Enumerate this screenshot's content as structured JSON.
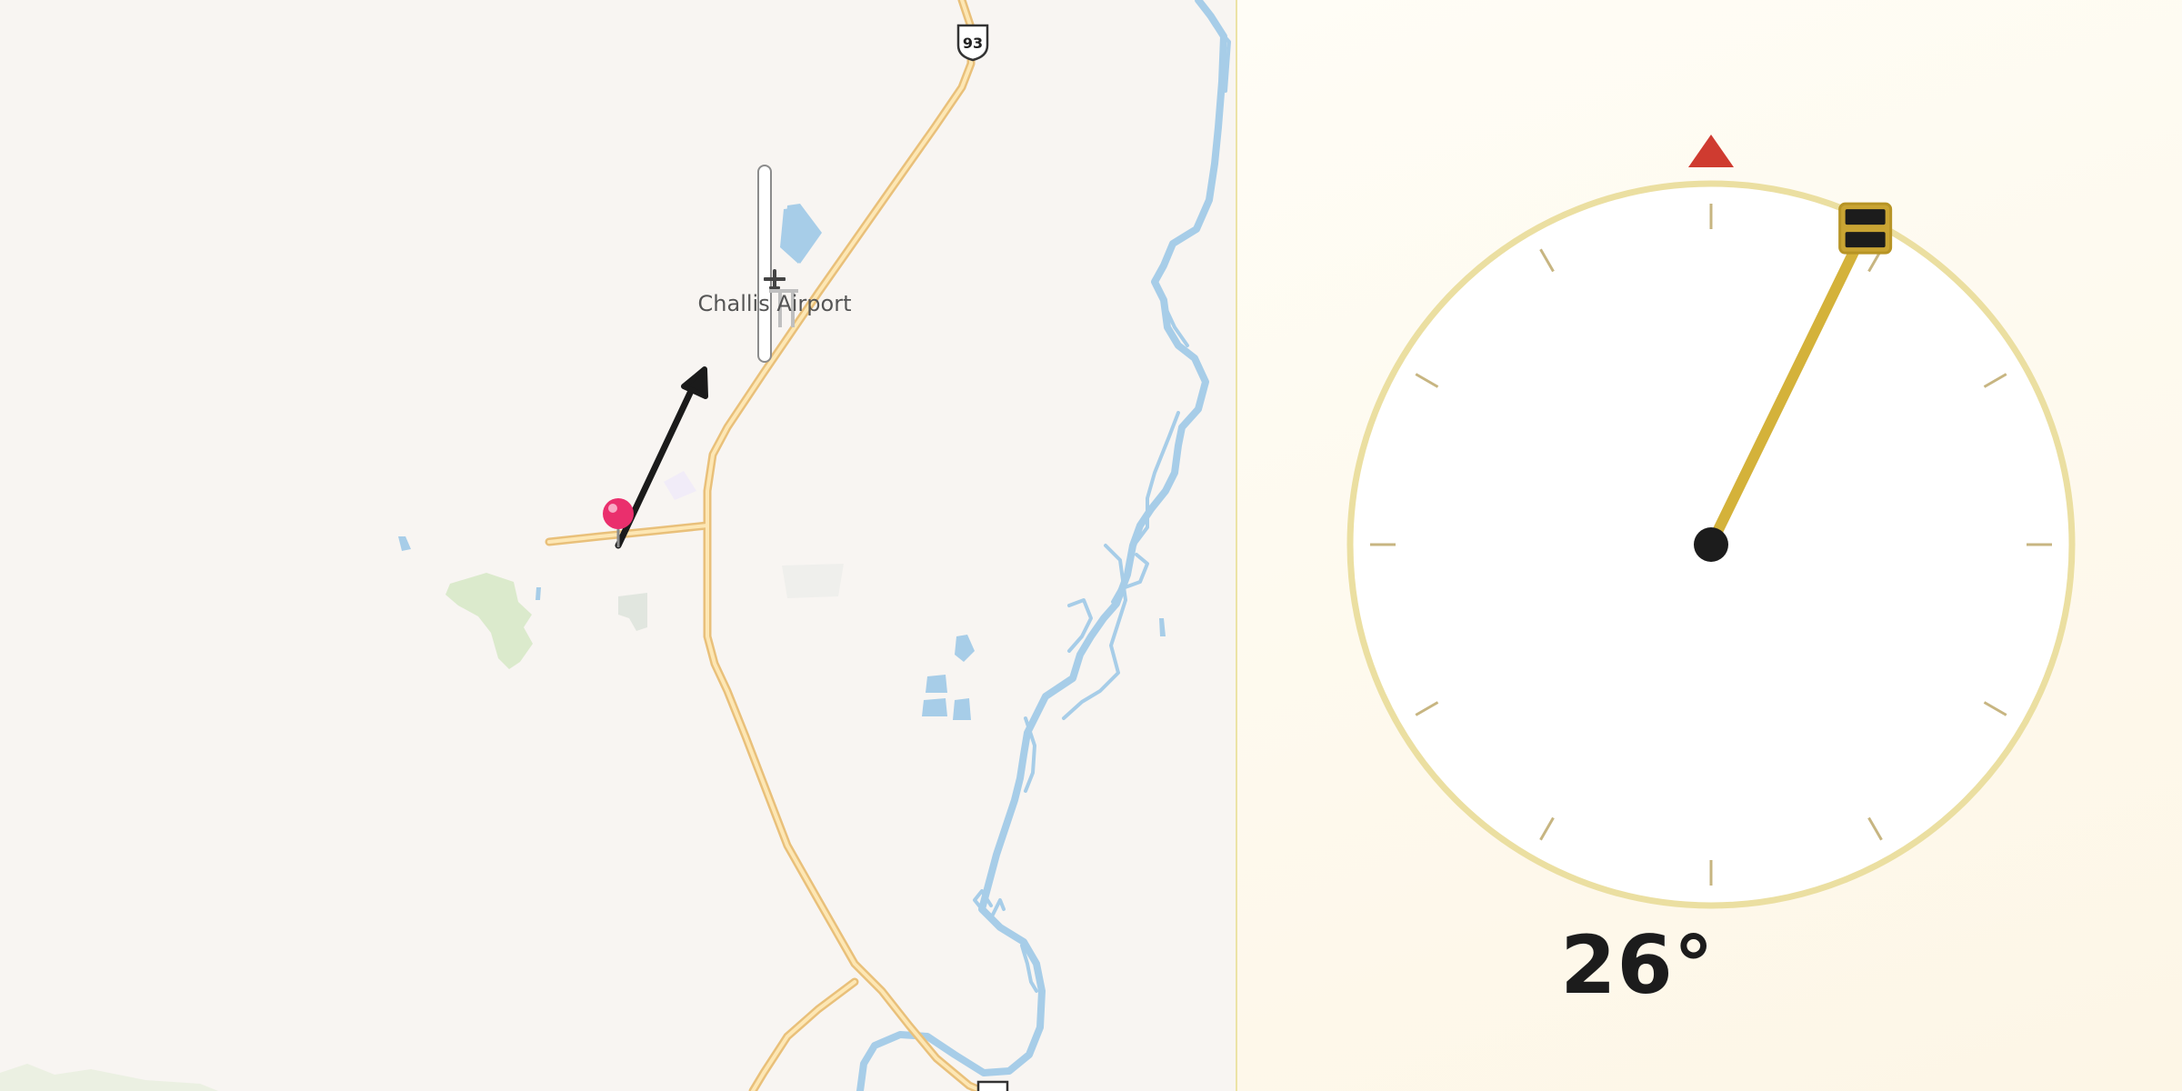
{
  "map": {
    "airport_label": "Challis Airport",
    "route_shields": [
      "93"
    ],
    "colors": {
      "background": "#f8f5f2",
      "road_casing": "#e9c07a",
      "road_fill": "#fde7b4",
      "water": "#a7cde8",
      "park": "#d6e7c6",
      "pin": "#ea2f6d",
      "bearing_arrow": "#1b1b1b"
    },
    "icons": [
      "airport-plane-icon",
      "location-pin-icon",
      "bearing-arrow-icon",
      "route-93-shield-icon"
    ]
  },
  "compass": {
    "heading_deg": 26,
    "heading_text": "26°",
    "colors": {
      "dial_face": "#ffffff",
      "dial_ring": "#ebdfa1",
      "ticks": "#c7b581",
      "needle": "#d4b23a",
      "north_marker": "#cf3b30",
      "hub": "#1c1c1c"
    },
    "icons": [
      "north-triangle-icon",
      "needle-hub-icon",
      "needle-handle-icon"
    ]
  }
}
